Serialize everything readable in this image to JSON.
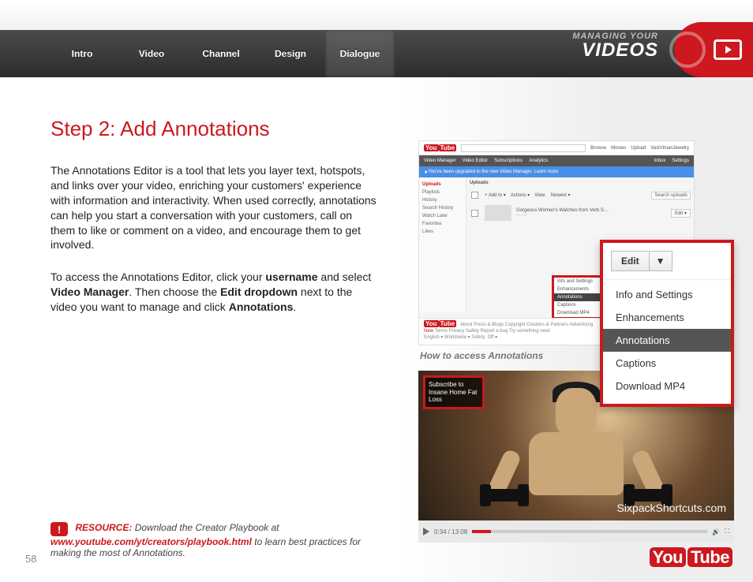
{
  "header": {
    "tabs": [
      "Intro",
      "Video",
      "Channel",
      "Design",
      "Dialogue"
    ],
    "active_tab_index": 4,
    "title_small": "MANAGING YOUR",
    "title_large": "VIDEOS"
  },
  "content": {
    "heading": "Step 2: Add Annotations",
    "para1": "The Annotations Editor is a tool that lets you layer text, hotspots, and links over your video, enriching your customers' experience with information and interactivity. When used correctly, annotations can help you start a conversation with your customers, call on them to like or comment on a video, and encourage them to get involved.",
    "para2_pre": "To access the Annotations Editor, click your ",
    "para2_b1": "username",
    "para2_mid1": " and select ",
    "para2_b2": "Video Manager",
    "para2_mid2": ". Then choose the ",
    "para2_b3": "Edit dropdown",
    "para2_mid3": " next to the video you want to manage and click ",
    "para2_b4": "Annotations",
    "para2_end": "."
  },
  "resource": {
    "label": "RESOURCE:",
    "text1": " Download the Creator Playbook at ",
    "url": "www.youtube.com/yt/creators/playbook.html",
    "text2": " to learn best practices for making the most of Annotations."
  },
  "page_number": "58",
  "shot1": {
    "logo_a": "You",
    "logo_b": "Tube",
    "top_links": [
      "Browse",
      "Movies",
      "Upload"
    ],
    "account": "VastVimanJewelry",
    "nav": [
      "Video Manager",
      "Video Editor",
      "Subscriptions",
      "Analytics"
    ],
    "nav_right": [
      "Inbox",
      "Settings"
    ],
    "banner": "You've been upgraded to the new Video Manager. Learn more",
    "side": [
      "Uploads",
      "Playlists",
      "History",
      "Search History",
      "Watch Later",
      "Favorites",
      "Likes"
    ],
    "uploads_title": "Uploads",
    "addto": "+ Add to ▾",
    "actions": "Actions ▾",
    "view": "View:",
    "newest": "Newest ▾",
    "search_ph": "Search uploads",
    "video_title": "Gorgeous Women's Watches from Verb S…",
    "edit": "Edit ▾",
    "mini": [
      "Info and Settings",
      "Enhancements",
      "Annotations",
      "Captions",
      "Download MP4"
    ],
    "caption": "How to access Annotations",
    "foot1": "About   Press & Blogs   Copyright   Creators & Partners   Advertising",
    "foot2": "Terms   Privacy   Safety   Report a bug   Try something new!",
    "foot3": "English ▾      Worldwide ▾      Safety: Off ▾"
  },
  "popout": {
    "button": "Edit",
    "items": [
      "Info and Settings",
      "Enhancements",
      "Annotations",
      "Captions",
      "Download MP4"
    ],
    "selected_index": 2
  },
  "shot2": {
    "annotation_text": "Subscribe to Insane Home Fat Loss",
    "watermark": "SixpackShortcuts.com",
    "time": "0:34 / 13:08"
  },
  "footer_logo": {
    "a": "You",
    "b": "Tube"
  }
}
